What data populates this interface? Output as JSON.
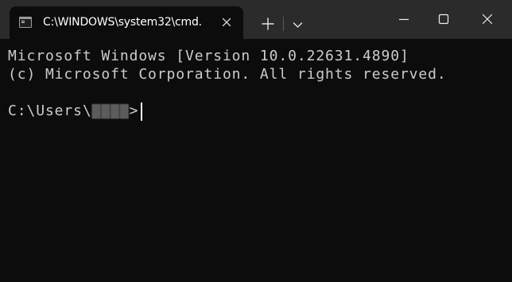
{
  "window": {
    "tab_title": "C:\\WINDOWS\\system32\\cmd.",
    "tab_icon": "cmd-icon",
    "controls": [
      "minimize-icon",
      "maximize-icon",
      "close-icon"
    ]
  },
  "terminal": {
    "lines": [
      "Microsoft Windows [Version 10.0.22631.4890]",
      "(c) Microsoft Corporation. All rights reserved."
    ],
    "prompt_path": "C:\\Users\\",
    "prompt_user": "▇▇▇▇",
    "prompt_suffix": ">"
  },
  "colors": {
    "titlebar": "#2b2b2b",
    "background": "#0c0c0c",
    "text": "#cccccc"
  }
}
